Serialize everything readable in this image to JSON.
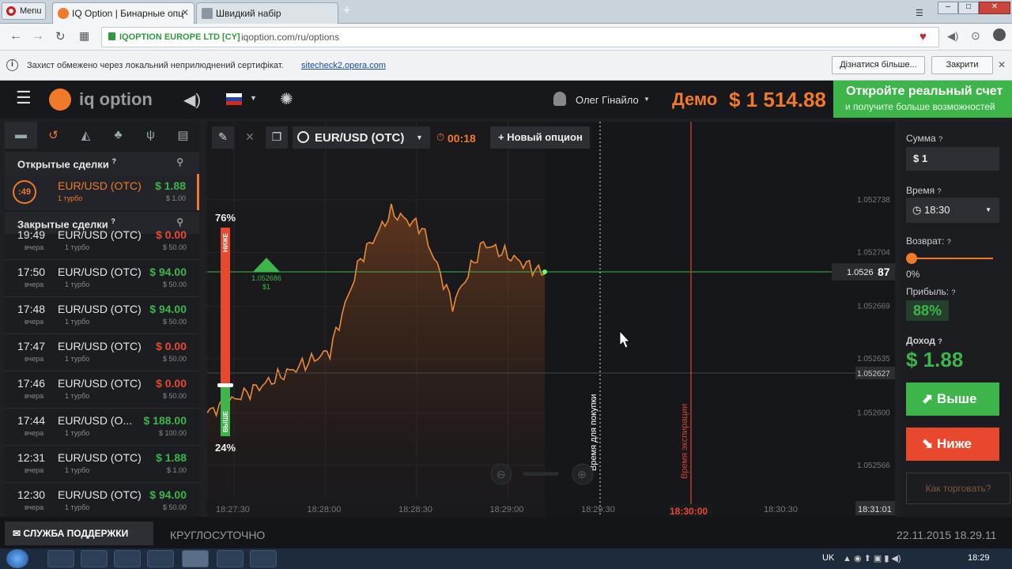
{
  "browser": {
    "menu_label": "Menu",
    "tabs": [
      {
        "label": "IQ Option | Бинарные опц"
      },
      {
        "label": "Швидкий набір"
      }
    ],
    "site_identity": "IQOPTION EUROPE LTD [CY]",
    "url": "iqoption.com/ru/options",
    "infobar_text": "Захист обмежено через локальний неприлюднений сертифікат.",
    "infobar_link": "sitecheck2.opera.com",
    "infobar_learn_more": "Дізнатися більше...",
    "infobar_close": "Закрити"
  },
  "header": {
    "logo_text": "iq option",
    "username": "Олег Гінайло",
    "mode_label": "Демо",
    "balance": "$ 1 514.88",
    "cta_title": "Откройте реальный счет",
    "cta_subtitle": "и получите больше возможностей"
  },
  "left_panel": {
    "open_deals_title": "Открытые сделки",
    "closed_deals_title": "Закрытые сделки",
    "open_deal": {
      "timer": ":49",
      "asset": "EUR/USD (OTC)",
      "type": "1 турбо",
      "profit": "$ 1.88",
      "stake": "$ 1.00"
    },
    "closed_deals": [
      {
        "time": "19:49",
        "day": "вчера",
        "asset": "EUR/USD (OTC)",
        "type": "1 турбо",
        "profit": "$ 0.00",
        "stake": "$ 50.00",
        "win": false
      },
      {
        "time": "17:50",
        "day": "вчера",
        "asset": "EUR/USD (OTC)",
        "type": "1 турбо",
        "profit": "$ 94.00",
        "stake": "$ 50.00",
        "win": true
      },
      {
        "time": "17:48",
        "day": "вчера",
        "asset": "EUR/USD (OTC)",
        "type": "1 турбо",
        "profit": "$ 94.00",
        "stake": "$ 50.00",
        "win": true
      },
      {
        "time": "17:47",
        "day": "вчера",
        "asset": "EUR/USD (OTC)",
        "type": "1 турбо",
        "profit": "$ 0.00",
        "stake": "$ 50.00",
        "win": false
      },
      {
        "time": "17:46",
        "day": "вчера",
        "asset": "EUR/USD (OTC)",
        "type": "1 турбо",
        "profit": "$ 0.00",
        "stake": "$ 50.00",
        "win": false
      },
      {
        "time": "17:44",
        "day": "вчера",
        "asset": "EUR/USD (O...",
        "type": "1 турбо",
        "profit": "$ 188.00",
        "stake": "$ 100.00",
        "win": true
      },
      {
        "time": "12:31",
        "day": "вчера",
        "asset": "EUR/USD (OTC)",
        "type": "1 турбо",
        "profit": "$ 1.88",
        "stake": "$ 1.00",
        "win": true
      },
      {
        "time": "12:30",
        "day": "вчера",
        "asset": "EUR/USD (OTC)",
        "type": "1 турбо",
        "profit": "$ 94.00",
        "stake": "$ 50.00",
        "win": true
      }
    ]
  },
  "chart_toolbar": {
    "asset": "EUR/USD (OTC)",
    "timer": "00:18",
    "new_option": "Новый опцион"
  },
  "chart_data": {
    "type": "area",
    "x": [
      "18:27:30",
      "18:27:40",
      "18:27:50",
      "18:28:00",
      "18:28:10",
      "18:28:20",
      "18:28:30",
      "18:28:40",
      "18:28:50",
      "18:29:00",
      "18:29:10",
      "18:29:14"
    ],
    "values": [
      1.0526,
      1.05261,
      1.05262,
      1.05263,
      1.05264,
      1.0527,
      1.05273,
      1.05272,
      1.05267,
      1.05271,
      1.0527,
      1.05269
    ],
    "current_value": "1.0526",
    "current_value_tail": "87",
    "second_value": "1.052627",
    "y_ticks": [
      "1.052738",
      "1.052704",
      "1.052669",
      "1.052635",
      "1.052600",
      "1.052566"
    ],
    "x_ticks": [
      "18:27:30",
      "18:28:00",
      "18:28:30",
      "18:29:00",
      "18:29:30",
      "18:30:00",
      "18:30:30",
      "18:31:01"
    ],
    "expiry_tick": "18:30:00",
    "entry_marker_value": "1.052686",
    "entry_marker_stake": "$1",
    "purchase_time_label": "Время для покупки",
    "expiration_label": "Время экспирации",
    "sentiment_high": "76%",
    "sentiment_low": "24%",
    "sentiment_high_label": "НИЖЕ",
    "sentiment_low_label": "ВЫШЕ"
  },
  "right_panel": {
    "amount_label": "Сумма",
    "amount_value": "$ 1",
    "time_label": "Время",
    "time_value": "18:30",
    "return_label": "Возврат:",
    "return_value": "0%",
    "profit_label": "Прибыль:",
    "profit_value": "88%",
    "income_label": "Доход",
    "income_value": "$ 1.88",
    "higher_button": "Выше",
    "lower_button": "Ниже",
    "how_to_trade": "Как торговать?"
  },
  "footer": {
    "support_button": "СЛУЖБА ПОДДЕРЖКИ",
    "support_hours": "КРУГЛОСУТОЧНО",
    "datetime": "22.11.2015 18.29.11"
  },
  "taskbar": {
    "language": "UK",
    "clock": "18:29"
  },
  "colors": {
    "green": "#3db54a",
    "red": "#e8492d",
    "orange": "#f0792a",
    "dark_bg": "#1f2024"
  }
}
